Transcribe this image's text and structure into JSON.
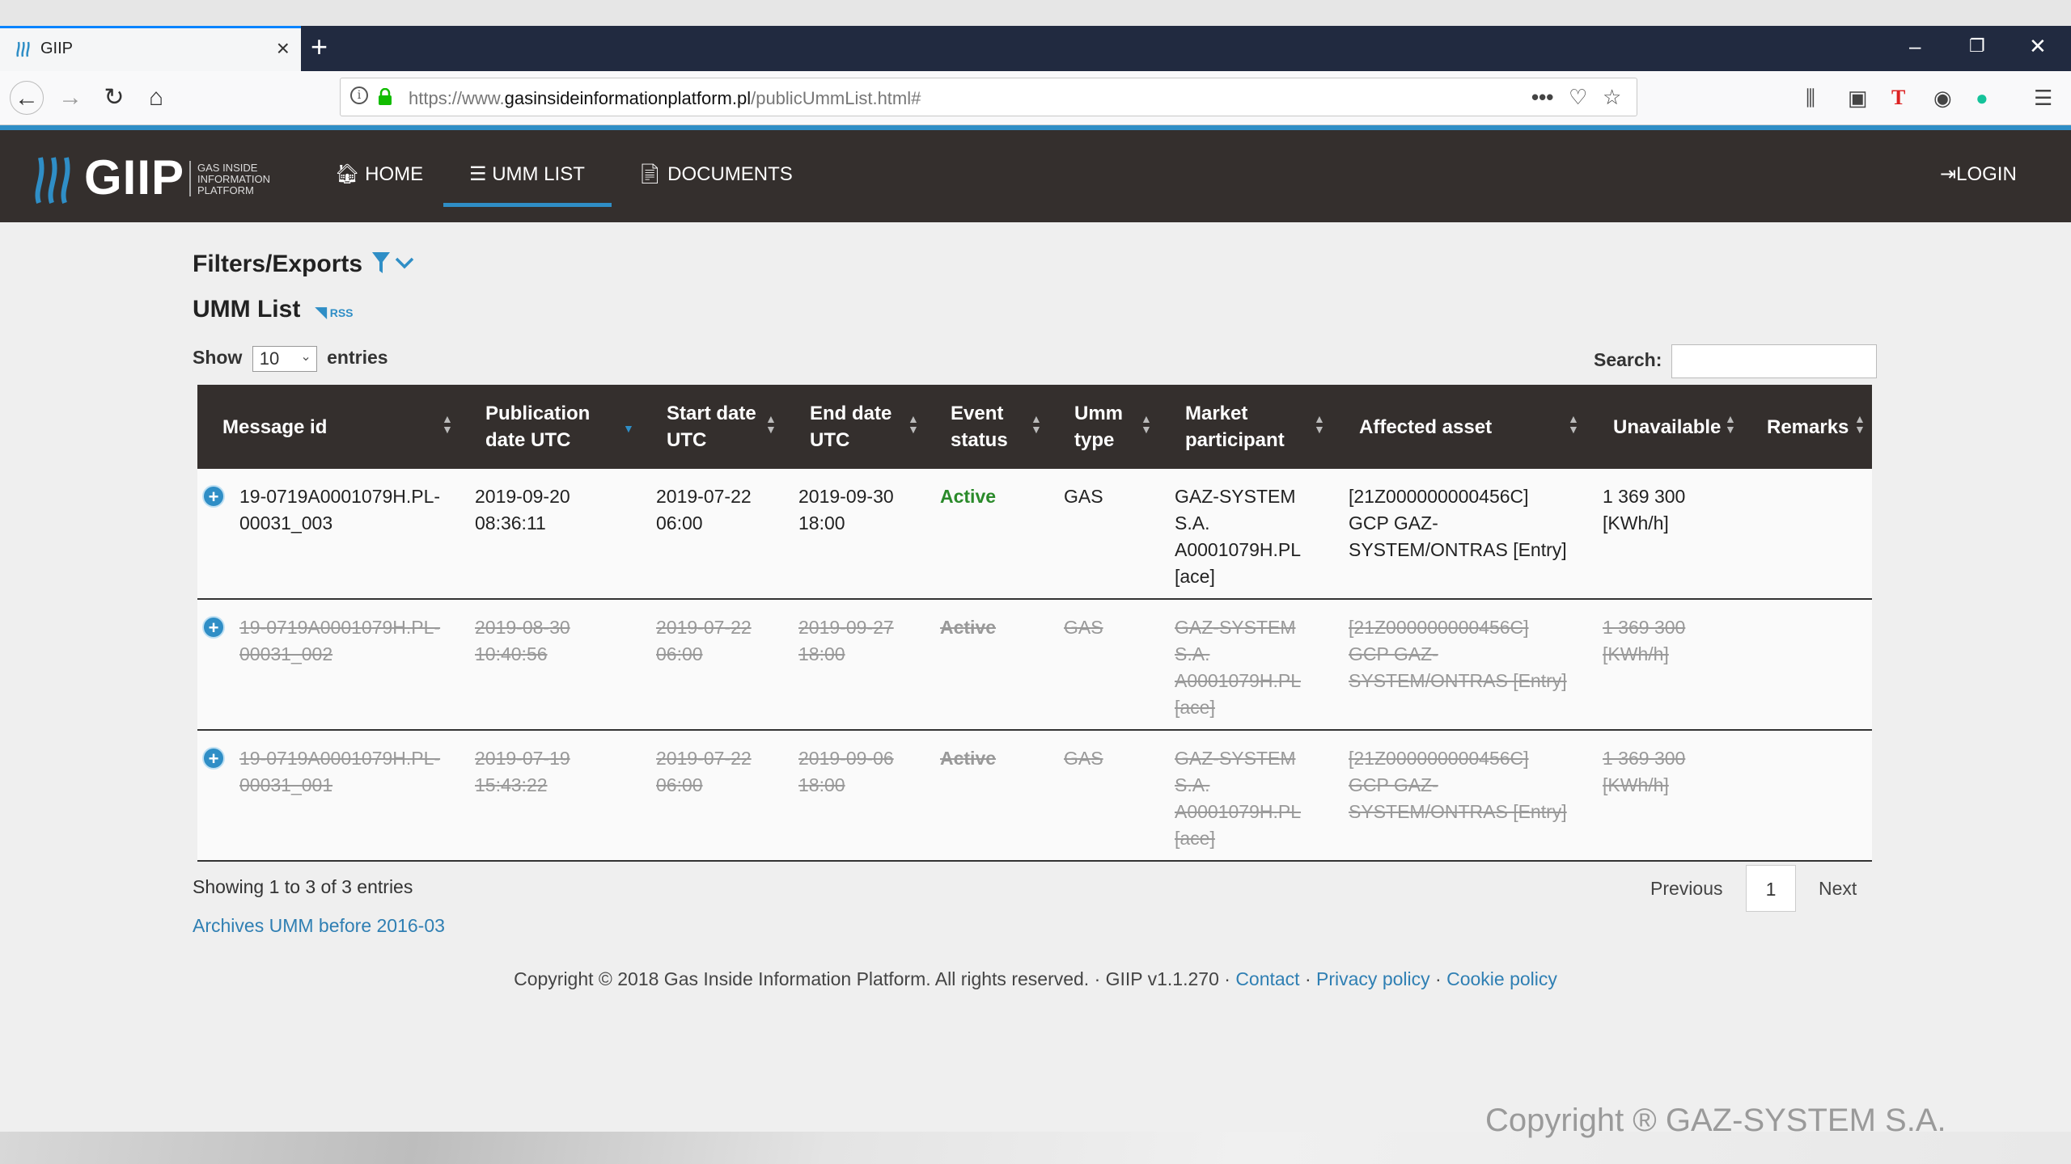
{
  "browser": {
    "tab_title": "GIIP",
    "url_prefix": "https://www.",
    "url_domain": "gasinsideinformationplatform.pl",
    "url_path": "/publicUmmList.html#"
  },
  "site": {
    "logo_text": "GIIP",
    "logo_sub_1": "GAS INSIDE",
    "logo_sub_2": "INFORMATION",
    "logo_sub_3": "PLATFORM",
    "menu": {
      "home": "HOME",
      "umm_list": "UMM LIST",
      "documents": "DOCUMENTS",
      "login": "LOGIN"
    }
  },
  "content": {
    "filters_title": "Filters/Exports",
    "umm_title": "UMM List",
    "rss_label": "RSS",
    "show_label": "Show",
    "show_value": "10",
    "entries_label": "entries",
    "search_label": "Search:"
  },
  "table": {
    "headers": {
      "message_id": "Message id",
      "publication_1": "Publication",
      "publication_2": "date UTC",
      "start_1": "Start date",
      "start_2": "UTC",
      "end_1": "End date",
      "end_2": "UTC",
      "event_1": "Event",
      "event_2": "status",
      "umm_1": "Umm",
      "umm_2": "type",
      "market_1": "Market",
      "market_2": "participant",
      "affected": "Affected asset",
      "unavailable": "Unavailable",
      "remarks": "Remarks"
    },
    "rows": [
      {
        "id_1": "19-0719A0001079H.PL-",
        "id_2": "00031_003",
        "pub_1": "2019-09-20",
        "pub_2": "08:36:11",
        "start_1": "2019-07-22",
        "start_2": "06:00",
        "end_1": "2019-09-30",
        "end_2": "18:00",
        "status": "Active",
        "type": "GAS",
        "mp_1": "GAZ-SYSTEM",
        "mp_2": "S.A.",
        "mp_3": "A0001079H.PL",
        "mp_4": "[ace]",
        "asset_1": "[21Z000000000456C]",
        "asset_2": "GCP GAZ-",
        "asset_3": "SYSTEM/ONTRAS [Entry]",
        "unavail_1": "1 369 300",
        "unavail_2": "[KWh/h]"
      },
      {
        "id_1": "19-0719A0001079H.PL-",
        "id_2": "00031_002",
        "pub_1": "2019-08-30",
        "pub_2": "10:40:56",
        "start_1": "2019-07-22",
        "start_2": "06:00",
        "end_1": "2019-09-27",
        "end_2": "18:00",
        "status": "Active",
        "type": "GAS",
        "mp_1": "GAZ-SYSTEM",
        "mp_2": "S.A.",
        "mp_3": "A0001079H.PL",
        "mp_4": "[ace]",
        "asset_1": "[21Z000000000456C]",
        "asset_2": "GCP GAZ-",
        "asset_3": "SYSTEM/ONTRAS [Entry]",
        "unavail_1": "1 369 300",
        "unavail_2": "[KWh/h]"
      },
      {
        "id_1": "19-0719A0001079H.PL-",
        "id_2": "00031_001",
        "pub_1": "2019-07-19",
        "pub_2": "15:43:22",
        "start_1": "2019-07-22",
        "start_2": "06:00",
        "end_1": "2019-09-06",
        "end_2": "18:00",
        "status": "Active",
        "type": "GAS",
        "mp_1": "GAZ-SYSTEM",
        "mp_2": "S.A.",
        "mp_3": "A0001079H.PL",
        "mp_4": "[ace]",
        "asset_1": "[21Z000000000456C]",
        "asset_2": "GCP GAZ-",
        "asset_3": "SYSTEM/ONTRAS [Entry]",
        "unavail_1": "1 369 300",
        "unavail_2": "[KWh/h]"
      }
    ]
  },
  "pagination": {
    "showing": "Showing 1 to 3 of 3 entries",
    "previous": "Previous",
    "page": "1",
    "next": "Next"
  },
  "archives_link": "Archives UMM before 2016-03",
  "footer": {
    "copyright": "Copyright © 2018 Gas Inside Information Platform. All rights reserved. · GIIP v1.1.270 ·",
    "contact": "Contact",
    "privacy": "Privacy policy",
    "cookie": "Cookie policy",
    "sep": "·"
  },
  "watermark": "Copyright ®  GAZ-SYSTEM S.A.",
  "colors": {
    "header_bg": "#342f2d",
    "accent": "#2f8ec6",
    "status_active": "#2a8a2a"
  }
}
